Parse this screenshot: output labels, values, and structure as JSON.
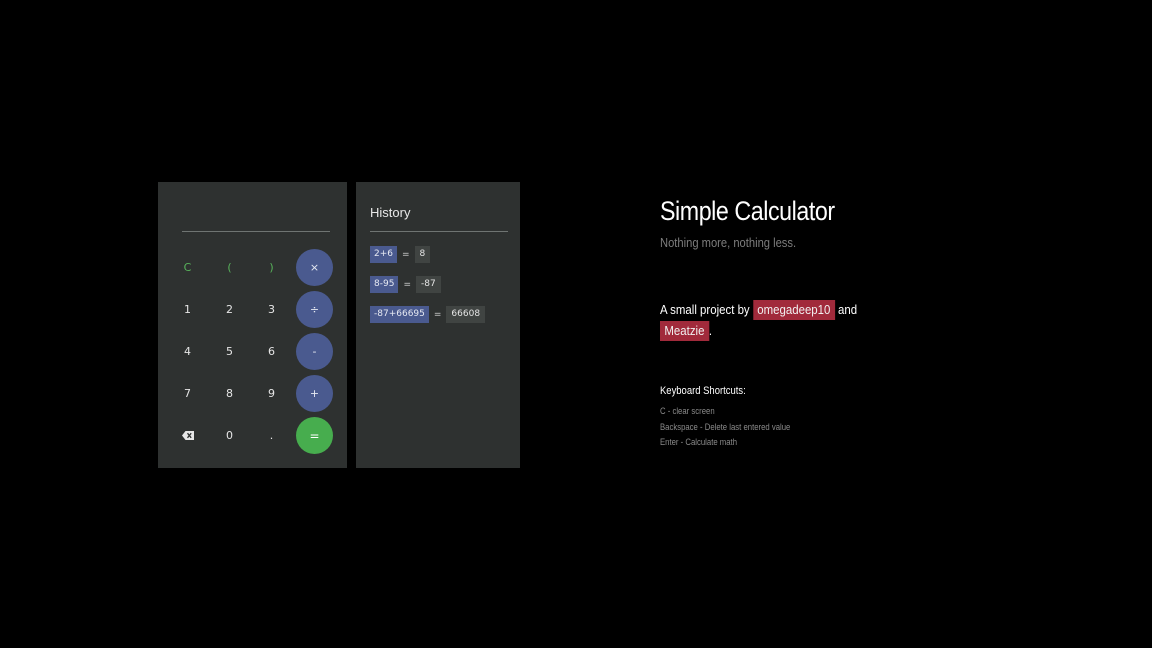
{
  "calculator": {
    "display": "",
    "keys": {
      "clear": "C",
      "open_paren": "(",
      "close_paren": ")",
      "multiply": "×",
      "one": "1",
      "two": "2",
      "three": "3",
      "divide": "÷",
      "four": "4",
      "five": "5",
      "six": "6",
      "subtract": "-",
      "seven": "7",
      "eight": "8",
      "nine": "9",
      "add": "+",
      "backspace_icon": "backspace-icon",
      "zero": "0",
      "decimal": ".",
      "equals": "="
    },
    "colors": {
      "operator": "#4a5a8f",
      "equals": "#47ad4e",
      "panel": "#2e3130",
      "function_text": "#58b35b"
    }
  },
  "history": {
    "title": "History",
    "entries": [
      {
        "expression": "2+6",
        "result": "8"
      },
      {
        "expression": "8-95",
        "result": "-87"
      },
      {
        "expression": "-87+66695",
        "result": "66608"
      }
    ],
    "equals_sign": "="
  },
  "info": {
    "title": "Simple Calculator",
    "subtitle": "Nothing more, nothing less.",
    "credits_prefix": "A small project by",
    "author1": "omegadeep10",
    "credits_and": "and",
    "author2": "Meatzie",
    "credits_suffix": ".",
    "shortcuts_title": "Keyboard Shortcuts:",
    "shortcuts": [
      "C - clear screen",
      "Backspace - Delete last entered value",
      "Enter - Calculate math"
    ],
    "colors": {
      "author_tag": "#a12a3b"
    }
  }
}
